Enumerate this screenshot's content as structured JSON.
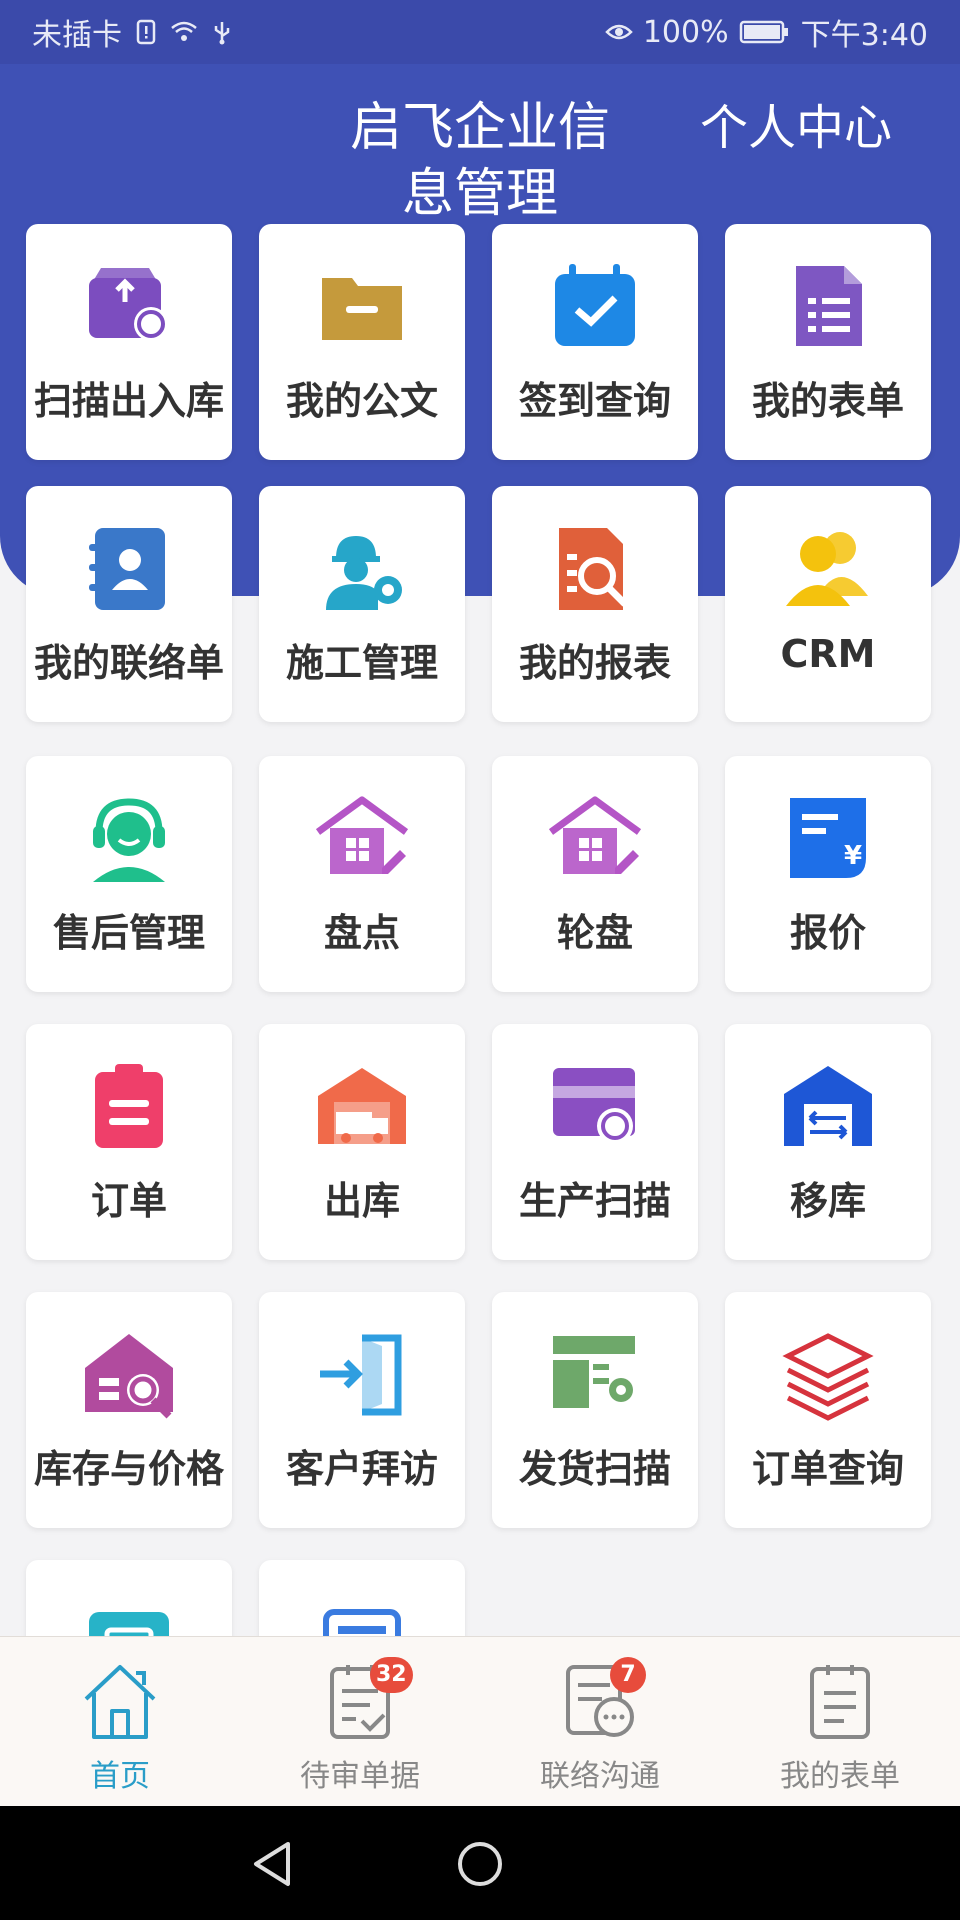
{
  "status_bar": {
    "carrier": "未插卡",
    "battery": "100%",
    "time": "下午3:40"
  },
  "header": {
    "title": "启飞企业信息管理",
    "personal_center": "个人中心"
  },
  "tiles": [
    {
      "label": "扫描出入库",
      "icon": "box-scan-icon",
      "color": "#7c4dbf"
    },
    {
      "label": "我的公文",
      "icon": "folder-icon",
      "color": "#c59a3c"
    },
    {
      "label": "签到查询",
      "icon": "calendar-check-icon",
      "color": "#1e88e5"
    },
    {
      "label": "我的表单",
      "icon": "form-list-icon",
      "color": "#7e57c2"
    },
    {
      "label": "我的联络单",
      "icon": "contact-book-icon",
      "color": "#3a78c9"
    },
    {
      "label": "施工管理",
      "icon": "worker-gear-icon",
      "color": "#26a6c9"
    },
    {
      "label": "我的报表",
      "icon": "report-search-icon",
      "color": "#e0603a"
    },
    {
      "label": "CRM",
      "icon": "people-icon",
      "color": "#f4c20d"
    },
    {
      "label": "售后管理",
      "icon": "headset-agent-icon",
      "color": "#1fbf8c"
    },
    {
      "label": "盘点",
      "icon": "house-edit-icon",
      "color": "#b455c6"
    },
    {
      "label": "轮盘",
      "icon": "house-edit-icon",
      "color": "#b455c6"
    },
    {
      "label": "报价",
      "icon": "quote-yen-icon",
      "color": "#1e6fe8"
    },
    {
      "label": "订单",
      "icon": "clipboard-icon",
      "color": "#ef3f6a"
    },
    {
      "label": "出库",
      "icon": "warehouse-truck-icon",
      "color": "#f06a4a"
    },
    {
      "label": "生产扫描",
      "icon": "card-scan-icon",
      "color": "#8a4fc2"
    },
    {
      "label": "移库",
      "icon": "warehouse-move-icon",
      "color": "#1e57d6"
    },
    {
      "label": "库存与价格",
      "icon": "house-search-icon",
      "color": "#b14b9e"
    },
    {
      "label": "客户拜访",
      "icon": "door-enter-icon",
      "color": "#2f9ee0"
    },
    {
      "label": "发货扫描",
      "icon": "sheet-gear-icon",
      "color": "#6ea86a"
    },
    {
      "label": "订单查询",
      "icon": "layers-icon",
      "color": "#d6333d"
    },
    {
      "label": "",
      "icon": "image-icon",
      "color": "#27b3c8"
    },
    {
      "label": "",
      "icon": "document-icon",
      "color": "#3a7be0"
    }
  ],
  "bottom_nav": [
    {
      "label": "首页",
      "icon": "home-icon",
      "badge": ""
    },
    {
      "label": "待审单据",
      "icon": "pending-doc-icon",
      "badge": "32"
    },
    {
      "label": "联络沟通",
      "icon": "chat-doc-icon",
      "badge": "7"
    },
    {
      "label": "我的表单",
      "icon": "form-icon",
      "badge": ""
    }
  ],
  "colors": {
    "header_bg": "#3f51b5",
    "status_bg": "#3b4aaa",
    "active_nav": "#2a9dc8",
    "badge": "#e74c3c"
  }
}
